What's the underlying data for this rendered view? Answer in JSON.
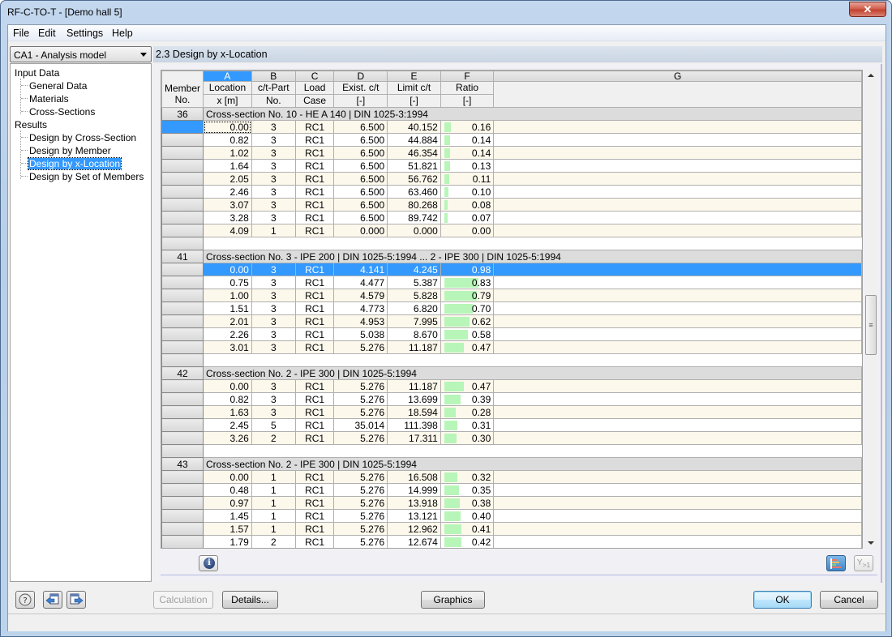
{
  "window": {
    "title": "RF-C-TO-T - [Demo hall 5]",
    "close_label": "X"
  },
  "menu": [
    "File",
    "Edit",
    "Settings",
    "Help"
  ],
  "case_combo": {
    "value": "CA1 - Analysis model"
  },
  "navigator": {
    "groups": [
      {
        "label": "Input Data",
        "items": [
          "General Data",
          "Materials",
          "Cross-Sections"
        ]
      },
      {
        "label": "Results",
        "items": [
          "Design by Cross-Section",
          "Design by Member",
          "Design by x-Location",
          "Design by Set of Members"
        ]
      }
    ],
    "selected": "Design by x-Location"
  },
  "section": {
    "title": "2.3 Design by x-Location"
  },
  "table": {
    "column_letters": [
      "A",
      "B",
      "C",
      "D",
      "E",
      "F",
      "G"
    ],
    "headers": {
      "member": [
        "Member",
        "No."
      ],
      "cols": [
        [
          "Location",
          "x [m]"
        ],
        [
          "c/t-Part",
          "No."
        ],
        [
          "Load",
          "Case"
        ],
        [
          "Exist. c/t",
          "[-]"
        ],
        [
          "Limit c/t",
          "[-]"
        ],
        [
          "Ratio",
          "[-]"
        ],
        [
          "",
          ""
        ]
      ]
    },
    "groups": [
      {
        "member": "36",
        "description": "Cross-section No.  10 - HE A 140 | DIN 1025-3:1994",
        "rows": [
          [
            "0.00",
            "3",
            "RC1",
            "6.500",
            "40.152",
            "0.16"
          ],
          [
            "0.82",
            "3",
            "RC1",
            "6.500",
            "44.884",
            "0.14"
          ],
          [
            "1.02",
            "3",
            "RC1",
            "6.500",
            "46.354",
            "0.14"
          ],
          [
            "1.64",
            "3",
            "RC1",
            "6.500",
            "51.821",
            "0.13"
          ],
          [
            "2.05",
            "3",
            "RC1",
            "6.500",
            "56.762",
            "0.11"
          ],
          [
            "2.46",
            "3",
            "RC1",
            "6.500",
            "63.460",
            "0.10"
          ],
          [
            "3.07",
            "3",
            "RC1",
            "6.500",
            "80.268",
            "0.08"
          ],
          [
            "3.28",
            "3",
            "RC1",
            "6.500",
            "89.742",
            "0.07"
          ],
          [
            "4.09",
            "1",
            "RC1",
            "0.000",
            "0.000",
            "0.00"
          ]
        ]
      },
      {
        "member": "41",
        "description": "Cross-section No. 3 - IPE 200 | DIN 1025-5:1994 ... 2 - IPE 300 | DIN 1025-5:1994",
        "rows": [
          [
            "0.00",
            "3",
            "RC1",
            "4.141",
            "4.245",
            "0.98"
          ],
          [
            "0.75",
            "3",
            "RC1",
            "4.477",
            "5.387",
            "0.83"
          ],
          [
            "1.00",
            "3",
            "RC1",
            "4.579",
            "5.828",
            "0.79"
          ],
          [
            "1.51",
            "3",
            "RC1",
            "4.773",
            "6.820",
            "0.70"
          ],
          [
            "2.01",
            "3",
            "RC1",
            "4.953",
            "7.995",
            "0.62"
          ],
          [
            "2.26",
            "3",
            "RC1",
            "5.038",
            "8.670",
            "0.58"
          ],
          [
            "3.01",
            "3",
            "RC1",
            "5.276",
            "11.187",
            "0.47"
          ]
        ]
      },
      {
        "member": "42",
        "description": "Cross-section No.  2 - IPE 300 | DIN 1025-5:1994",
        "rows": [
          [
            "0.00",
            "3",
            "RC1",
            "5.276",
            "11.187",
            "0.47"
          ],
          [
            "0.82",
            "3",
            "RC1",
            "5.276",
            "13.699",
            "0.39"
          ],
          [
            "1.63",
            "3",
            "RC1",
            "5.276",
            "18.594",
            "0.28"
          ],
          [
            "2.45",
            "5",
            "RC1",
            "35.014",
            "111.398",
            "0.31"
          ],
          [
            "3.26",
            "2",
            "RC1",
            "5.276",
            "17.311",
            "0.30"
          ]
        ]
      },
      {
        "member": "43",
        "description": "Cross-section No.  2 - IPE 300 | DIN 1025-5:1994",
        "rows": [
          [
            "0.00",
            "1",
            "RC1",
            "5.276",
            "16.508",
            "0.32"
          ],
          [
            "0.48",
            "1",
            "RC1",
            "5.276",
            "14.999",
            "0.35"
          ],
          [
            "0.97",
            "1",
            "RC1",
            "5.276",
            "13.918",
            "0.38"
          ],
          [
            "1.45",
            "1",
            "RC1",
            "5.276",
            "13.121",
            "0.40"
          ],
          [
            "1.57",
            "1",
            "RC1",
            "5.276",
            "12.962",
            "0.41"
          ],
          [
            "1.79",
            "2",
            "RC1",
            "5.276",
            "12.674",
            "0.42"
          ]
        ]
      }
    ],
    "selected_row": {
      "group": 1,
      "row": 0
    },
    "focused_cell": {
      "group": 0,
      "row": 0
    },
    "ratio_bar_color": "#b8f5b8",
    "selection_color": "#3399ff"
  },
  "buttons": {
    "calculation": "Calculation",
    "details": "Details...",
    "graphics": "Graphics",
    "ok": "OK",
    "cancel": "Cancel"
  }
}
